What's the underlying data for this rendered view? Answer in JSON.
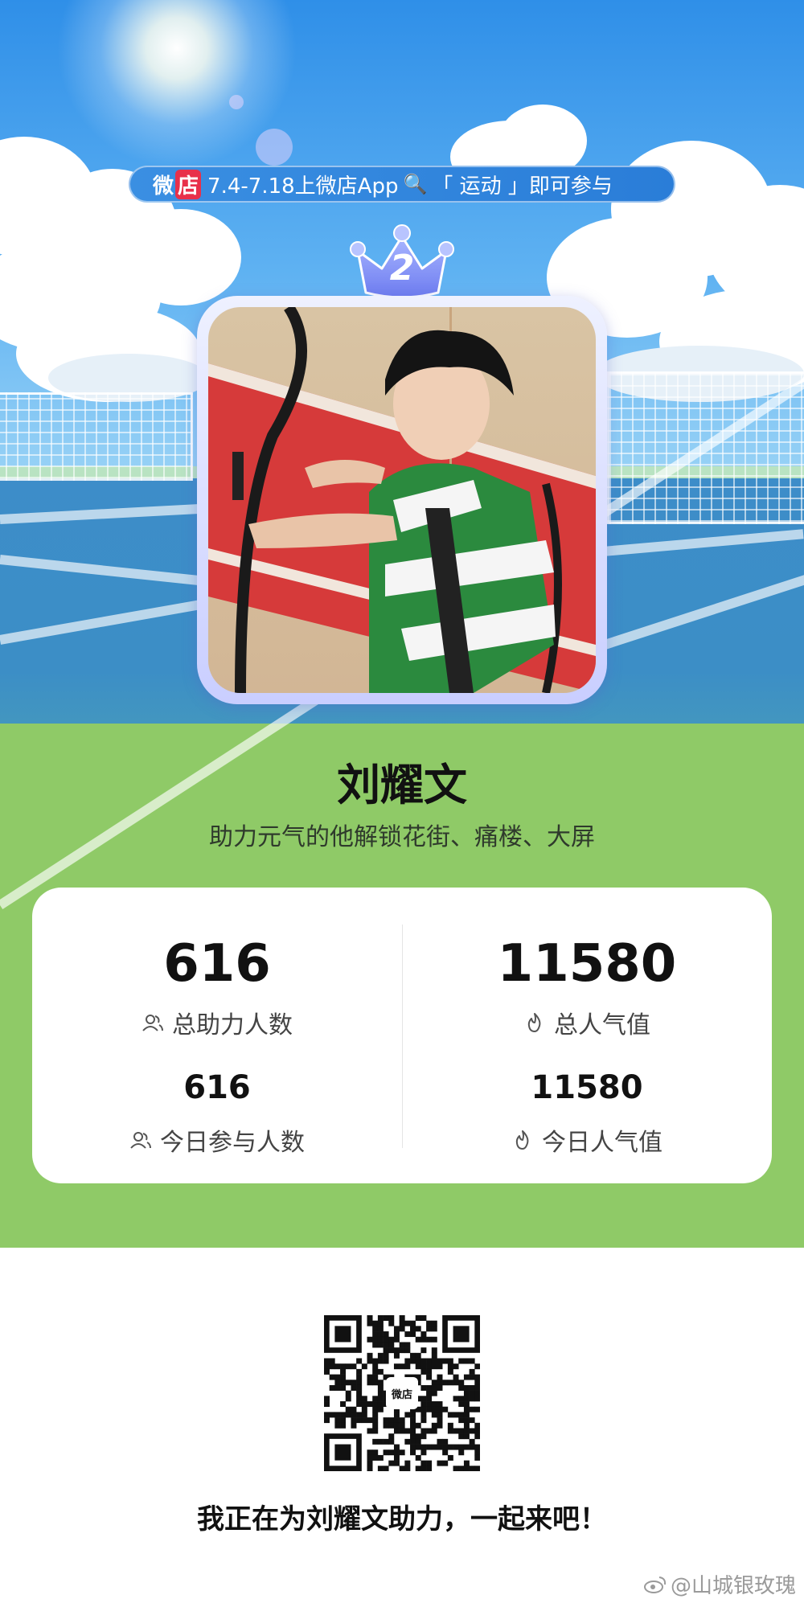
{
  "banner": {
    "logo_a": "微",
    "logo_b": "店",
    "text": "7.4-7.18上微店App",
    "search_glyph": "🔍",
    "keyword": "「 运动 」即可参与"
  },
  "rank": "2",
  "name": "刘耀文",
  "tagline": "助力元气的他解锁花街、痛楼、大屏",
  "stats": {
    "total_supporters_value": "616",
    "total_supporters_label": "总助力人数",
    "total_popularity_value": "11580",
    "total_popularity_label": "总人气值",
    "today_participants_value": "616",
    "today_participants_label": "今日参与人数",
    "today_popularity_value": "11580",
    "today_popularity_label": "今日人气值"
  },
  "qr": {
    "center_label": "微店"
  },
  "invite": "我正在为刘耀文助力，一起来吧！",
  "watermark": "@山城银玫瑰",
  "colors": {
    "sky": "#5fb2f2",
    "court_blue": "#3d8dc9",
    "court_green": "#8fca67",
    "crown": "#7d8cf6",
    "brand_red": "#e8304a"
  }
}
